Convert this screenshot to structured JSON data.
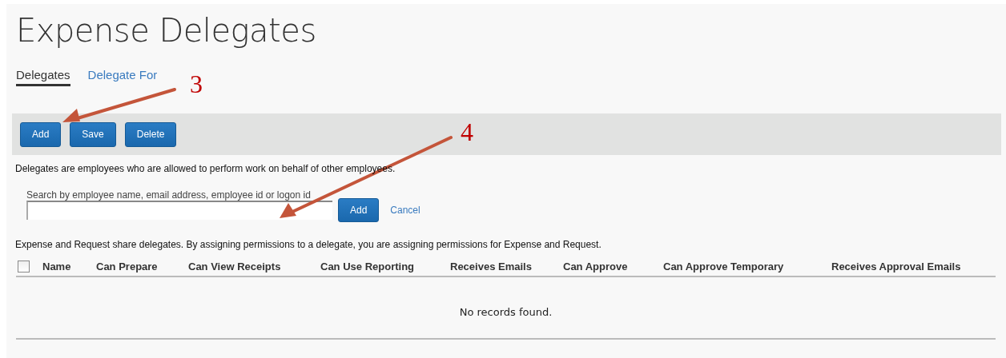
{
  "page": {
    "title": "Expense Delegates"
  },
  "tabs": [
    {
      "label": "Delegates",
      "selected": true
    },
    {
      "label": "Delegate For",
      "selected": false
    }
  ],
  "toolbar": {
    "buttons": [
      "Add",
      "Save",
      "Delete"
    ]
  },
  "description": "Delegates are employees who are allowed to perform work on behalf of other employees.",
  "search": {
    "label": "Search by employee name, email address, employee id or logon id",
    "add_button": "Add",
    "cancel_link": "Cancel"
  },
  "share_note": "Expense and Request share delegates. By assigning permissions to a delegate, you are assigning permissions for Expense and Request.",
  "table": {
    "select_all": {
      "checked": false
    },
    "columns": [
      "Name",
      "Can Prepare",
      "Can View Receipts",
      "Can Use Reporting",
      "Receives Emails",
      "Can Approve",
      "Can Approve Temporary",
      "Receives Approval Emails"
    ],
    "empty_message": "No records found."
  },
  "annotations": [
    {
      "label": "3"
    },
    {
      "label": "4"
    }
  ]
}
